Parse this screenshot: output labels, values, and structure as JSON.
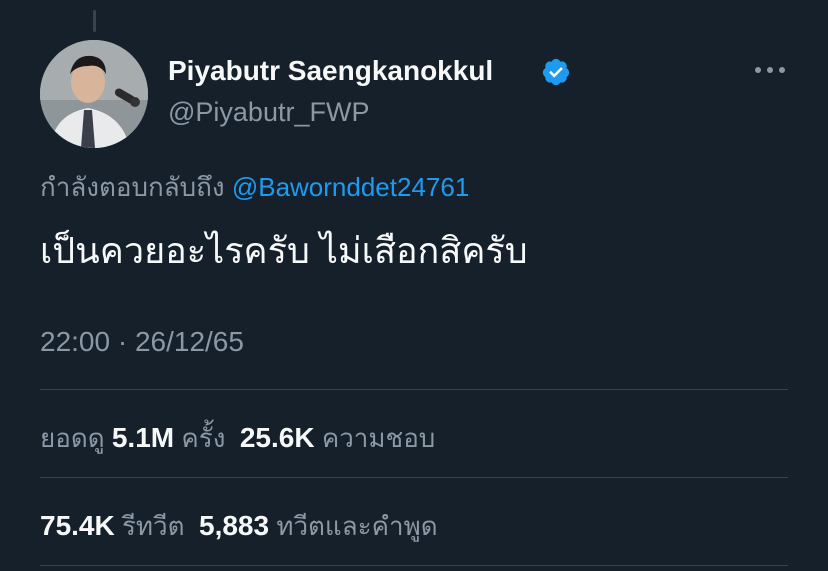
{
  "author": {
    "display_name": "Piyabutr Saengkanokkul",
    "handle": "@Piyabutr_FWP",
    "verified_icon": "verified-badge-icon",
    "verified_color": "#1d9bf0"
  },
  "reply": {
    "prefix": "กำลังตอบกลับถึง",
    "mention": "@Bawornddet24761"
  },
  "tweet": {
    "text": "เป็นควยอะไรครับ ไม่เสือกสิครับ",
    "timestamp": "22:00 · 26/12/65"
  },
  "stats": {
    "views_label": "ยอดดู",
    "views_value": "5.1M",
    "views_unit": "ครั้ง",
    "likes_value": "25.6K",
    "likes_label": "ความชอบ",
    "retweets_value": "75.4K",
    "retweets_label": "รีทวีต",
    "quotes_value": "5,883",
    "quotes_label": "ทวีตและคำพูด"
  },
  "colors": {
    "background": "#15202b",
    "secondary_text": "#8b98a5",
    "link": "#1d9bf0"
  }
}
